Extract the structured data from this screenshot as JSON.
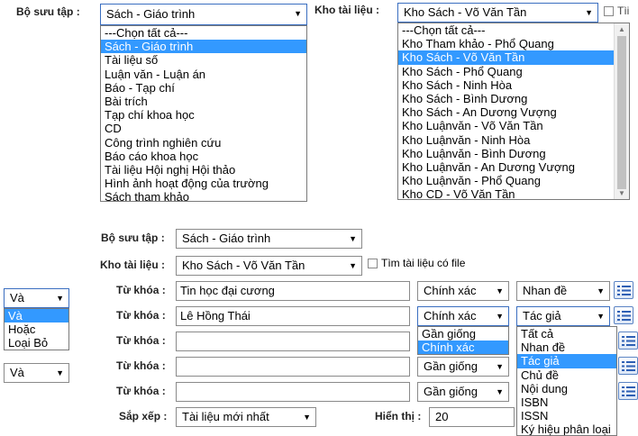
{
  "top": {
    "collection_label": "Bộ sưu tập :",
    "collection_value": "Sách - Giáo trình",
    "collection_options": [
      "---Chọn tất cả---",
      "Sách - Giáo trình",
      "Tài liệu số",
      "Luận văn - Luận án",
      "Báo - Tạp chí",
      "Bài trích",
      "Tạp chí khoa học",
      "CD",
      "Công trình nghiên cứu",
      "Báo cáo khoa học",
      "Tài liệu Hội nghị Hội thảo",
      "Hình ảnh hoạt động của trường",
      "Sách tham khảo"
    ],
    "collection_selected_index": 1,
    "store_label": "Kho tài liệu :",
    "store_value": "Kho Sách - Võ Văn Tần",
    "store_options": [
      "---Chọn tất cả---",
      "Kho Tham khảo - Phổ Quang",
      "Kho Sách - Võ Văn Tần",
      "Kho Sách - Phổ Quang",
      "Kho Sách - Ninh Hòa",
      "Kho Sách - Bình Dương",
      "Kho Sách - An Dương Vượng",
      "Kho Luậnvăn - Võ Văn Tần",
      "Kho Luậnvăn - Ninh Hòa",
      "Kho Luậnvăn - Bình Dương",
      "Kho Luậnvăn - An Dương Vượng",
      "Kho Luậnvăn - Phổ Quang",
      "Kho CD - Võ Văn Tần"
    ],
    "store_selected_index": 2,
    "file_checkbox_label": "Tìi"
  },
  "form": {
    "collection_label": "Bộ sưu tập :",
    "collection_value": "Sách - Giáo trình",
    "store_label": "Kho tài liệu :",
    "store_value": "Kho Sách - Võ Văn Tần",
    "file_checkbox_label": "Tìm tài liệu có file",
    "keyword_label": "Từ khóa :",
    "rows": [
      {
        "logic": "Và",
        "value": "Tin học đại cương",
        "match": "Chính xác",
        "field": "Nhan đề"
      },
      {
        "logic": "",
        "value": "Lê Hồng Thái",
        "match": "Chính xác",
        "field": "Tác giả"
      },
      {
        "logic": "",
        "value": "",
        "match": "Gần giống",
        "field": ""
      },
      {
        "logic": "Và",
        "value": "",
        "match": "Gần giống",
        "field": ""
      },
      {
        "logic": "",
        "value": "",
        "match": "Gần giống",
        "field": ""
      }
    ],
    "logic_options": [
      "Và",
      "Hoặc",
      "Loại Bỏ"
    ],
    "logic_selected_index": 0,
    "match_options": [
      "Gần giống",
      "Chính xác"
    ],
    "match_selected_index": 1,
    "field_options": [
      "Tất cả",
      "Nhan đề",
      "Tác giả",
      "Chủ đề",
      "Nội dung",
      "ISBN",
      "ISSN",
      "Ký hiệu phân loại"
    ],
    "field_selected_index": 2,
    "sort_label": "Sắp xếp :",
    "sort_value": "Tài liệu mới nhất",
    "show_label": "Hiển thị :",
    "show_value": "20"
  },
  "colors": {
    "highlight": "#3399ff",
    "border": "#8a8a8a",
    "icon_blue": "#2d5fb4"
  }
}
